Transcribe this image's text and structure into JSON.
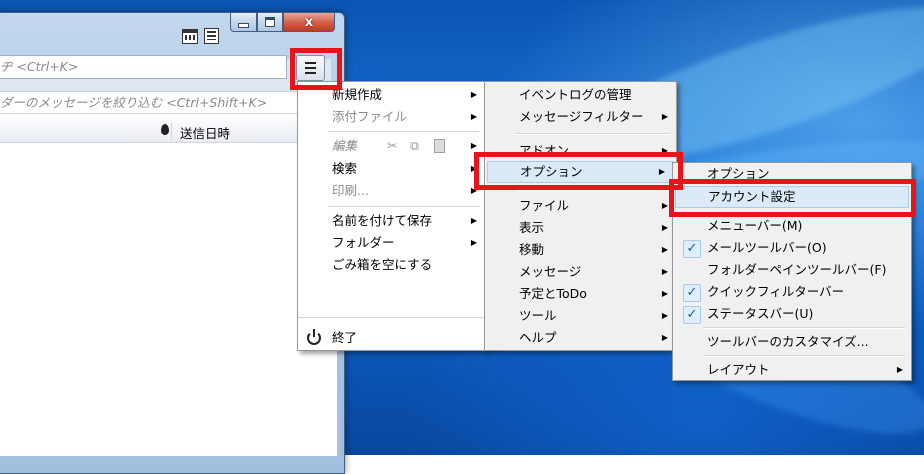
{
  "colors": {
    "highlight_red": "#e7151a",
    "menu_bg": "#f0f0f0",
    "check_blue": "#1a5aa8"
  },
  "window": {
    "close_label": "x",
    "icons": [
      "calendar-icon",
      "tasks-icon",
      "minimize-icon",
      "maximize-icon",
      "close-icon",
      "hamburger-menu-icon"
    ]
  },
  "search": {
    "placeholder": "ヂ <Ctrl+K>"
  },
  "filter": {
    "placeholder": "ダーのメッセージを絞り込む <Ctrl+Shift+K>"
  },
  "message_list": {
    "columns": [
      "送信日時"
    ]
  },
  "menu_main": {
    "items": [
      "新規作成",
      "添付ファイル",
      "編集",
      "検索",
      "印刷...",
      "名前を付けて保存",
      "フォルダー",
      "ごみ箱を空にする"
    ],
    "quit": "終了"
  },
  "menu_options": {
    "items": [
      "イベントログの管理",
      "メッセージフィルター",
      "アドオン",
      "オプション",
      "ファイル",
      "表示",
      "移動",
      "メッセージ",
      "予定とToDo",
      "ツール",
      "ヘルプ"
    ]
  },
  "menu_sub": {
    "items": [
      "オプション",
      "アカウント設定",
      "メニューバー(M)",
      "メールツールバー(O)",
      "フォルダーペインツールバー(F)",
      "クイックフィルターバー",
      "ステータスバー(U)",
      "ツールバーのカスタマイズ...",
      "レイアウト"
    ],
    "checked": [
      false,
      false,
      false,
      true,
      false,
      true,
      true,
      false,
      false
    ]
  }
}
